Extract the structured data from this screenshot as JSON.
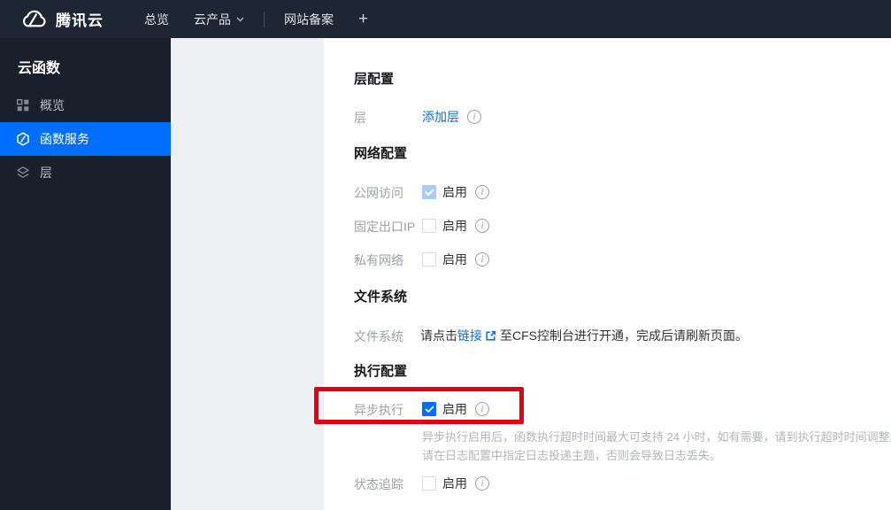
{
  "topbar": {
    "logo_label": "腾讯云",
    "nav_overview": "总览",
    "nav_products": "云产品",
    "nav_icp": "网站备案",
    "nav_add": "+"
  },
  "sidebar": {
    "title": "云函数",
    "items": [
      {
        "label": "概览",
        "icon": "grid-icon",
        "active": false
      },
      {
        "label": "函数服务",
        "icon": "function-service-icon",
        "active": true
      },
      {
        "label": "层",
        "icon": "layers-icon",
        "active": false
      }
    ]
  },
  "sections": {
    "layer": {
      "title": "层配置",
      "row_label": "层",
      "add_layer_link": "添加层"
    },
    "network": {
      "title": "网络配置",
      "rows": [
        {
          "label": "公网访问",
          "enable_label": "启用",
          "checked": true,
          "disabled": true
        },
        {
          "label": "固定出口IP",
          "enable_label": "启用",
          "checked": false,
          "disabled": false
        },
        {
          "label": "私有网络",
          "enable_label": "启用",
          "checked": false,
          "disabled": false
        }
      ]
    },
    "filesystem": {
      "title": "文件系统",
      "row_label": "文件系统",
      "text_before": "请点击",
      "link_text": "链接",
      "text_after": "至CFS控制台进行开通，完成后请刷新页面。"
    },
    "execution": {
      "title": "执行配置",
      "async_row": {
        "label": "异步执行",
        "enable_label": "启用",
        "checked": true
      },
      "async_note_line1": "异步执行启用后，函数执行超时时间最大可支持 24 小时，如有需要，请到执行超时时间调整。",
      "async_note_line2": "请在日志配置中指定日志投递主题，否则会导致日志丢失。",
      "trace_row": {
        "label": "状态追踪",
        "enable_label": "启用",
        "checked": false
      }
    }
  },
  "colors": {
    "accent_blue": "#006eff",
    "annotation_red": "#e60012",
    "topbar_bg": "#1e2634",
    "sidebar_bg": "#1a202b",
    "disabled_check_blue": "#a9cdf8"
  }
}
